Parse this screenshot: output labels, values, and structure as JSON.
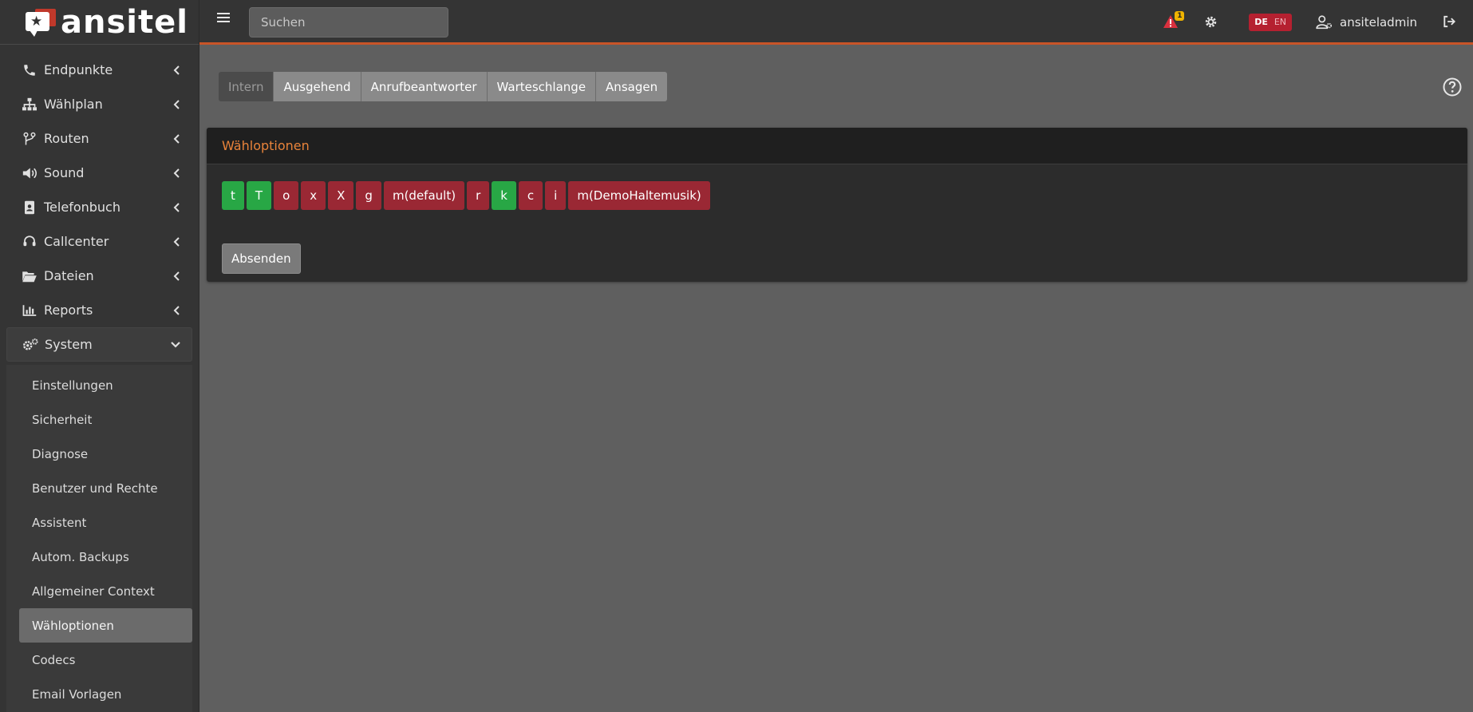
{
  "brand": {
    "name": "ansitel"
  },
  "header": {
    "search_placeholder": "Suchen",
    "alert_count": "1",
    "lang_de": "DE",
    "lang_en": "EN",
    "username": "ansiteladmin"
  },
  "sidebar": {
    "items": [
      {
        "label": "Endpunkte",
        "icon": "phone-icon"
      },
      {
        "label": "Wählplan",
        "icon": "sitemap-icon"
      },
      {
        "label": "Routen",
        "icon": "route-icon"
      },
      {
        "label": "Sound",
        "icon": "volume-icon"
      },
      {
        "label": "Telefonbuch",
        "icon": "address-book-icon"
      },
      {
        "label": "Callcenter",
        "icon": "headset-icon"
      },
      {
        "label": "Dateien",
        "icon": "folder-open-icon"
      },
      {
        "label": "Reports",
        "icon": "chart-icon"
      },
      {
        "label": "System",
        "icon": "cogs-icon"
      }
    ],
    "system_sub": [
      "Einstellungen",
      "Sicherheit",
      "Diagnose",
      "Benutzer und Rechte",
      "Assistent",
      "Autom. Backups",
      "Allgemeiner Context",
      "Wähloptionen",
      "Codecs",
      "Email Vorlagen"
    ]
  },
  "tabs": [
    "Intern",
    "Ausgehend",
    "Anrufbeantworter",
    "Warteschlange",
    "Ansagen"
  ],
  "card": {
    "title": "Wähloptionen",
    "options": [
      {
        "label": "t",
        "state": "on"
      },
      {
        "label": "T",
        "state": "on"
      },
      {
        "label": "o",
        "state": "off"
      },
      {
        "label": "x",
        "state": "off"
      },
      {
        "label": "X",
        "state": "off"
      },
      {
        "label": "g",
        "state": "off"
      },
      {
        "label": "m(default)",
        "state": "off"
      },
      {
        "label": "r",
        "state": "off"
      },
      {
        "label": "k",
        "state": "on"
      },
      {
        "label": "c",
        "state": "off"
      },
      {
        "label": "i",
        "state": "off"
      },
      {
        "label": "m(DemoHaltemusik)",
        "state": "off"
      }
    ],
    "submit_label": "Absenden"
  },
  "colors": {
    "accent": "#e8833a",
    "on": "#28a745",
    "off": "#9a2834",
    "header_border": "#c85428"
  }
}
